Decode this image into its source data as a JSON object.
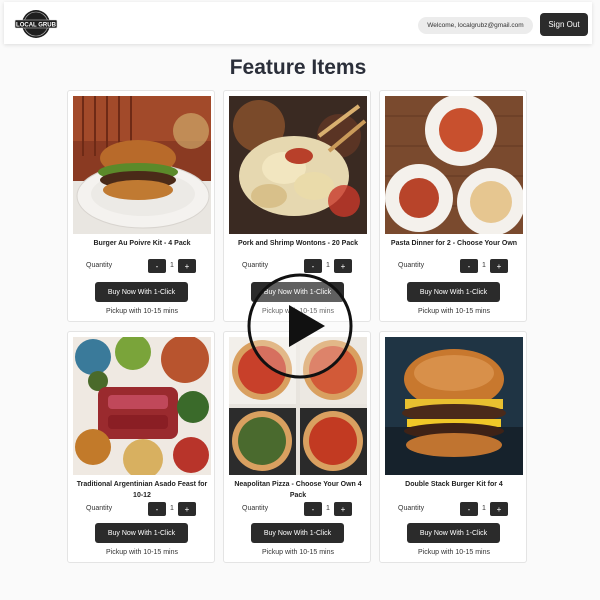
{
  "header": {
    "logo_text": "LOCAL GRUB",
    "welcome_text": "Welcome, localgrubz@gmail.com",
    "sign_out_label": "Sign Out"
  },
  "page": {
    "title": "Feature Items"
  },
  "products": [
    {
      "name": "Burger Au Poivre Kit - 4 Pack",
      "quantity_label": "Quantity",
      "minus": "-",
      "quantity": "1",
      "plus": "+",
      "buy_label": "Buy Now With 1-Click",
      "pickup": "Pickup with 10-15 mins"
    },
    {
      "name": "Pork and Shrimp Wontons - 20 Pack",
      "quantity_label": "Quantity",
      "minus": "-",
      "quantity": "1",
      "plus": "+",
      "buy_label": "Buy Now With 1-Click",
      "pickup": "Pickup with 10-15 mins"
    },
    {
      "name": "Pasta Dinner for 2 - Choose Your Own",
      "quantity_label": "Quantity",
      "minus": "-",
      "quantity": "1",
      "plus": "+",
      "buy_label": "Buy Now With 1-Click",
      "pickup": "Pickup with 10-15 mins"
    },
    {
      "name": "Traditional Argentinian Asado Feast for 10-12",
      "quantity_label": "Quantity",
      "minus": "-",
      "quantity": "1",
      "plus": "+",
      "buy_label": "Buy Now With 1-Click",
      "pickup": "Pickup with 10-15 mins"
    },
    {
      "name": "Neapolitan Pizza - Choose Your Own 4 Pack",
      "quantity_label": "Quantity",
      "minus": "-",
      "quantity": "1",
      "plus": "+",
      "buy_label": "Buy Now With 1-Click",
      "pickup": "Pickup with 10-15 mins"
    },
    {
      "name": "Double Stack Burger Kit for 4",
      "quantity_label": "Quantity",
      "minus": "-",
      "quantity": "1",
      "plus": "+",
      "buy_label": "Buy Now With 1-Click",
      "pickup": "Pickup with 10-15 mins"
    }
  ],
  "icons": {
    "logo": "local-grub-logo",
    "play": "play-icon"
  },
  "colors": {
    "button_dark": "#2b2b2b",
    "title": "#2b2f3a"
  }
}
